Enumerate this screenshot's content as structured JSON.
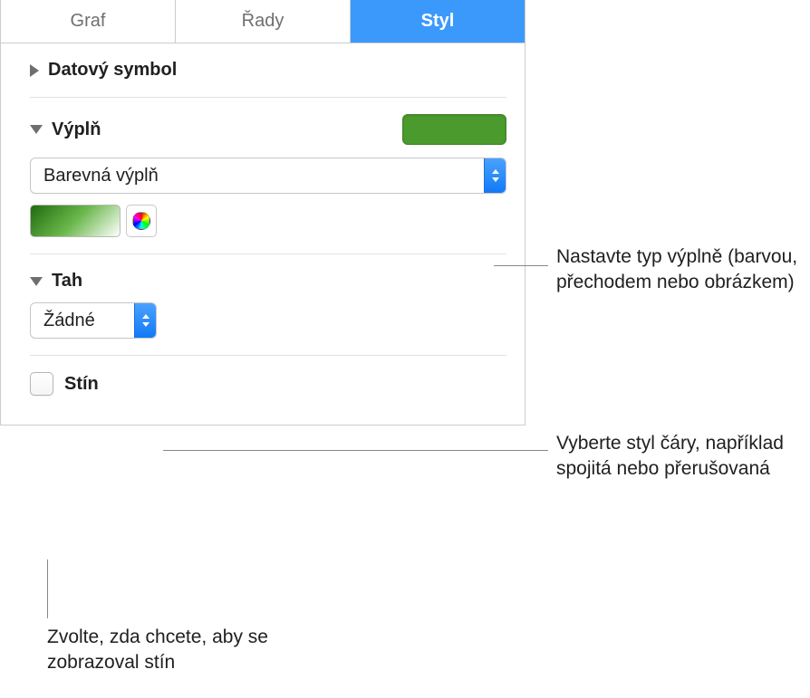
{
  "tabs": {
    "chart": "Graf",
    "series": "Řady",
    "style": "Styl"
  },
  "sections": {
    "data_symbol": {
      "title": "Datový symbol"
    },
    "fill": {
      "title": "Výplň",
      "type_label": "Barevná výplň",
      "color": "#4b9a2d"
    },
    "stroke": {
      "title": "Tah",
      "type_label": "Žádné"
    },
    "shadow": {
      "title": "Stín",
      "checked": false
    }
  },
  "callouts": {
    "fill_type": "Nastavte typ výplně (barvou, přechodem nebo obrázkem)",
    "stroke_style": "Vyberte styl čáry, například spojitá nebo přerušovaná",
    "shadow_enable": "Zvolte, zda chcete, aby se zobrazoval stín"
  }
}
